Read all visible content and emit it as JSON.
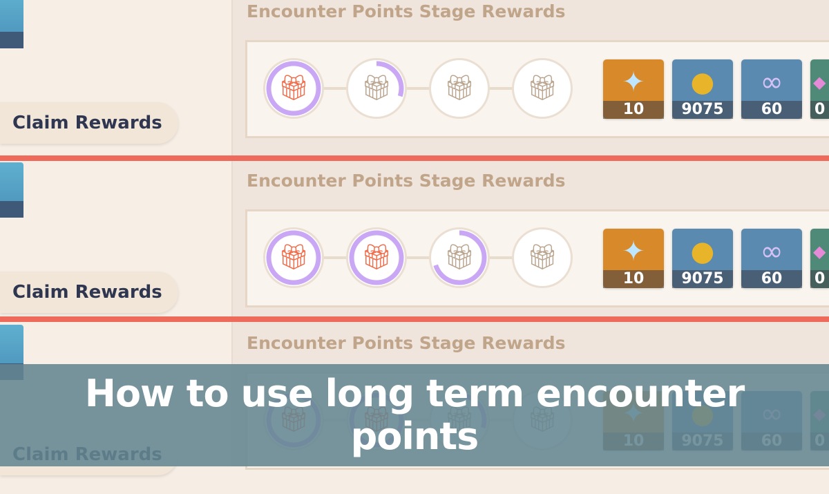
{
  "sections": [
    {
      "title": "Encounter Points Stage Rewards",
      "claim_label": "Claim Rewards",
      "stages": [
        1,
        0.3,
        0,
        0
      ],
      "items": [
        {
          "icon": "primogem-icon",
          "count": "10"
        },
        {
          "icon": "mora-icon",
          "count": "9075"
        },
        {
          "icon": "fate-icon",
          "count": "60"
        },
        {
          "icon": "crystal-icon",
          "count": "0"
        }
      ]
    },
    {
      "title": "Encounter Points Stage Rewards",
      "claim_label": "Claim Rewards",
      "stages": [
        1,
        1,
        0.7,
        0
      ],
      "items": [
        {
          "icon": "primogem-icon",
          "count": "10"
        },
        {
          "icon": "mora-icon",
          "count": "9075"
        },
        {
          "icon": "fate-icon",
          "count": "60"
        },
        {
          "icon": "crystal-icon",
          "count": "0"
        }
      ]
    },
    {
      "title": "Encounter Points Stage Rewards",
      "claim_label": "Claim Rewards",
      "stages": [
        1,
        1,
        0.3,
        0
      ],
      "items": [
        {
          "icon": "primogem-icon",
          "count": "10"
        },
        {
          "icon": "mora-icon",
          "count": "9075"
        },
        {
          "icon": "fate-icon",
          "count": "60"
        },
        {
          "icon": "crystal-icon",
          "count": "0"
        }
      ]
    }
  ],
  "banner": {
    "title": "How to use long term encounter points"
  },
  "colors": {
    "highlight_line": "#ee6b5b",
    "progress": "#c9a7f5",
    "gift_ready": "#f06a47",
    "gift_locked": "#b9a38d",
    "banner": "#648692"
  }
}
